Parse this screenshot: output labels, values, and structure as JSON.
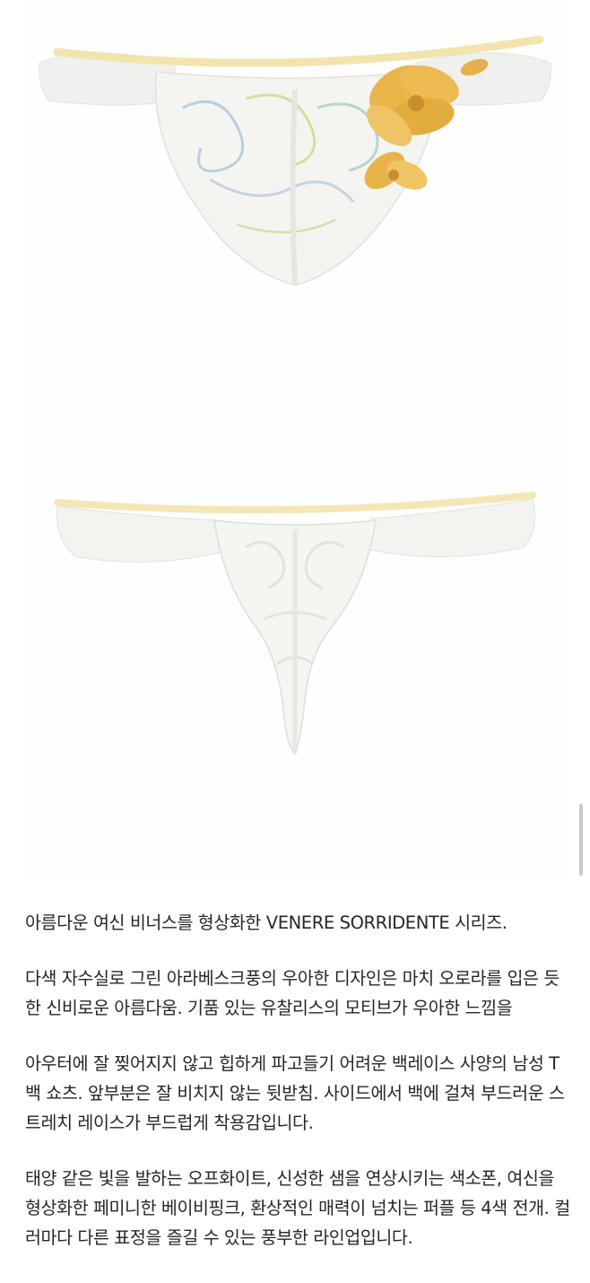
{
  "images": {
    "front": {
      "icon": "lace-brief-front-image"
    },
    "back": {
      "icon": "lace-thong-back-image"
    }
  },
  "colors": {
    "background": "#ffffff",
    "lace": "#f3f3ee",
    "waistband": "#f4e7b8",
    "flower_gold": "#e8b64a",
    "text": "#262626",
    "scrollbar": "#c8c8c8"
  },
  "description": {
    "paragraphs": [
      "아름다운 여신 비너스를 형상화한 VENERE SORRIDENTE 시리즈.",
      "다색 자수실로 그린 아라베스크풍의 우아한 디자인은 마치 오로라를 입은 듯한 신비로운 아름다움. 기품 있는 유찰리스의 모티브가 우아한 느낌을",
      "아우터에 잘 찢어지지 않고 힙하게 파고들기 어려운 백레이스 사양의 남성 T백 쇼츠. 앞부분은 잘 비치지 않는 뒷받침. 사이드에서 백에 걸쳐 부드러운 스트레치 레이스가 부드럽게 착용감입니다.",
      "태양 같은 빛을 발하는 오프화이트, 신성한 샘을 연상시키는 색소폰, 여신을 형상화한 페미니한 베이비핑크, 환상적인 매력이 넘치는 퍼플 등 4색 전개. 컬러마다 다른 표정을 즐길 수 있는 풍부한 라인업입니다."
    ]
  }
}
